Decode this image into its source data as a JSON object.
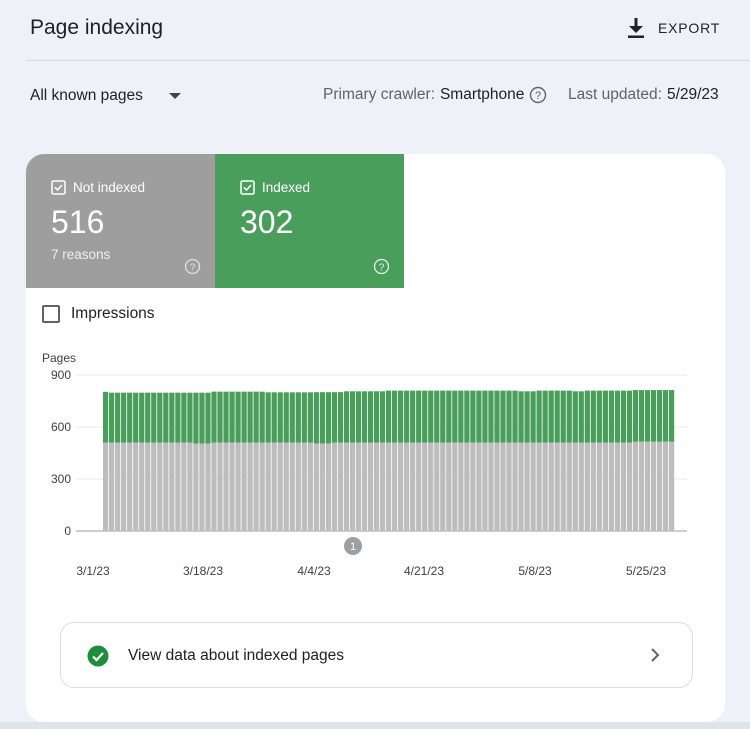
{
  "header": {
    "title": "Page indexing",
    "export_label": "EXPORT"
  },
  "filter": {
    "selected": "All known pages"
  },
  "meta": {
    "crawler_label": "Primary crawler:",
    "crawler_value": "Smartphone",
    "updated_label": "Last updated:",
    "updated_value": "5/29/23"
  },
  "tiles": {
    "not_indexed": {
      "label": "Not indexed",
      "count": "516",
      "sub": "7 reasons",
      "color": "#9e9e9e"
    },
    "indexed": {
      "label": "Indexed",
      "count": "302",
      "color": "#4a9e5c"
    }
  },
  "impressions": {
    "label": "Impressions"
  },
  "chart_data": {
    "type": "bar",
    "stacked": true,
    "ylabel": "Pages",
    "ylim": [
      0,
      900
    ],
    "yticks": [
      "900",
      "600",
      "300",
      "0"
    ],
    "xticks": [
      "3/1/23",
      "3/18/23",
      "4/4/23",
      "4/21/23",
      "5/8/23",
      "5/25/23"
    ],
    "annotation": "1",
    "grid": true,
    "series": [
      {
        "name": "Not indexed",
        "color": "#bdbdbd",
        "values": [
          510,
          510,
          510,
          510,
          510,
          510,
          510,
          510,
          510,
          510,
          510,
          510,
          510,
          510,
          510,
          505,
          505,
          505,
          510,
          510,
          510,
          510,
          510,
          510,
          510,
          510,
          510,
          510,
          510,
          510,
          510,
          510,
          510,
          510,
          510,
          505,
          505,
          505,
          510,
          510,
          510,
          510,
          510,
          510,
          510,
          510,
          510,
          510,
          510,
          510,
          510,
          510,
          510,
          510,
          510,
          510,
          510,
          510,
          510,
          510,
          510,
          510,
          510,
          510,
          510,
          510,
          510,
          510,
          510,
          510,
          510,
          510,
          510,
          510,
          510,
          510,
          510,
          510,
          510,
          510,
          510,
          510,
          510,
          510,
          510,
          510,
          510,
          510,
          515,
          515,
          515,
          515,
          515,
          515,
          515
        ]
      },
      {
        "name": "Indexed",
        "color": "#4a9e5c",
        "values": [
          293,
          288,
          288,
          288,
          288,
          288,
          288,
          288,
          288,
          288,
          288,
          288,
          288,
          288,
          288,
          293,
          293,
          293,
          294,
          294,
          294,
          294,
          294,
          294,
          294,
          294,
          294,
          290,
          290,
          290,
          290,
          290,
          290,
          290,
          290,
          296,
          296,
          296,
          291,
          291,
          296,
          296,
          296,
          296,
          296,
          296,
          296,
          300,
          300,
          300,
          300,
          300,
          300,
          300,
          300,
          300,
          300,
          300,
          300,
          300,
          300,
          300,
          300,
          300,
          300,
          300,
          300,
          300,
          300,
          296,
          296,
          296,
          300,
          300,
          300,
          300,
          300,
          300,
          296,
          296,
          300,
          300,
          300,
          300,
          300,
          300,
          300,
          300,
          298,
          298,
          298,
          298,
          298,
          298,
          298
        ]
      }
    ]
  },
  "view_link": {
    "label": "View data about indexed pages"
  }
}
